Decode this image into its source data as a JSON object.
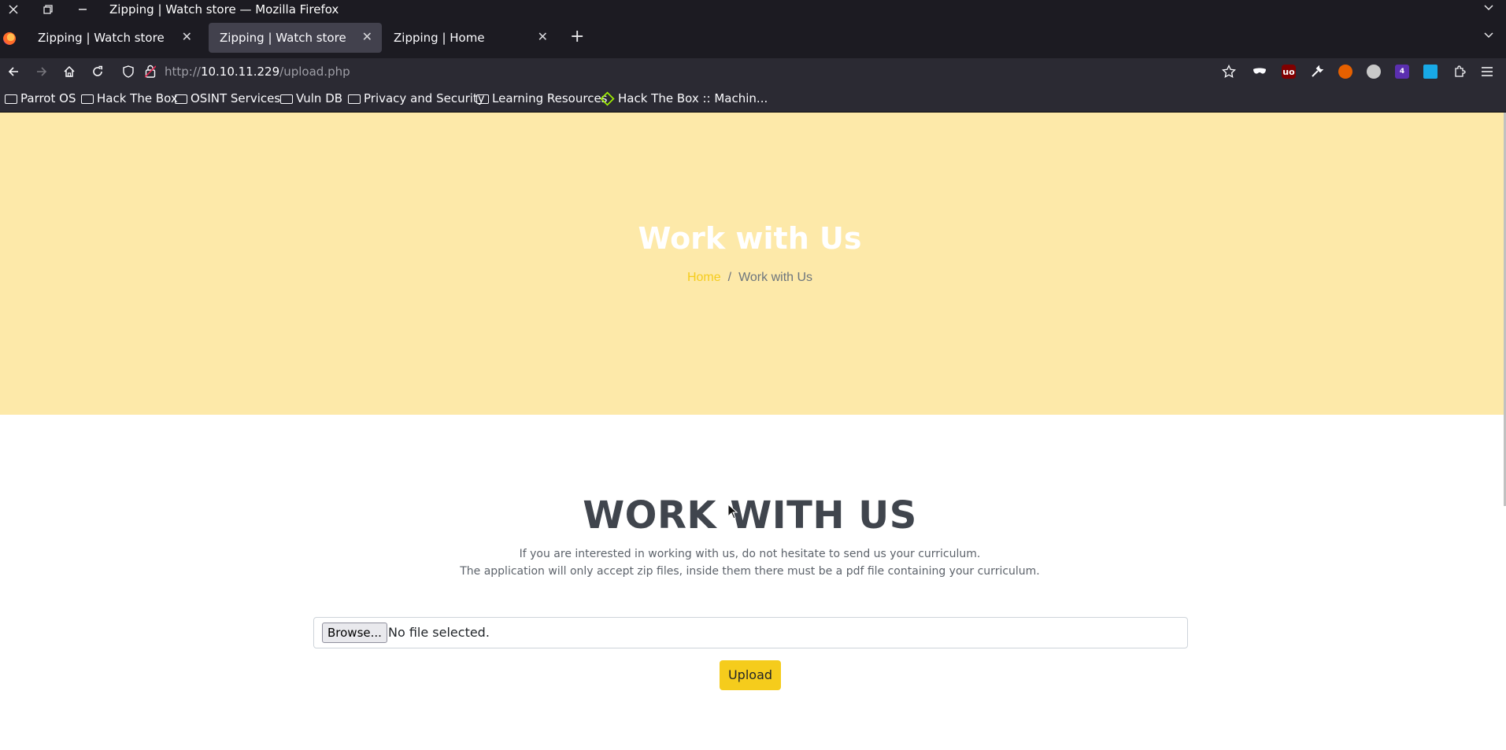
{
  "window": {
    "title": "Zipping | Watch store — Mozilla Firefox"
  },
  "tabs": [
    {
      "label": "Zipping | Watch store",
      "active": false
    },
    {
      "label": "Zipping | Watch store",
      "active": true
    },
    {
      "label": "Zipping | Home",
      "active": false
    }
  ],
  "navbar": {
    "url_prefix": "http://",
    "url_host": "10.10.11.229",
    "url_path": "/upload.php"
  },
  "bookmarks": [
    {
      "label": "Parrot OS",
      "icon": "folder-icon"
    },
    {
      "label": "Hack The Box",
      "icon": "folder-icon"
    },
    {
      "label": "OSINT Services",
      "icon": "folder-icon"
    },
    {
      "label": "Vuln DB",
      "icon": "folder-icon"
    },
    {
      "label": "Privacy and Security",
      "icon": "folder-icon"
    },
    {
      "label": "Learning Resources",
      "icon": "folder-icon"
    },
    {
      "label": "Hack The Box :: Machin...",
      "icon": "htb-cube-icon"
    }
  ],
  "hero": {
    "title": "Work with Us",
    "breadcrumb_home": "Home",
    "breadcrumb_sep": "/",
    "breadcrumb_current": "Work with Us"
  },
  "main": {
    "title": "WORK WITH US",
    "line1": "If you are interested in working with us, do not hesitate to send us your curriculum.",
    "line2": "The application will only accept zip files, inside them there must be a pdf file containing your curriculum.",
    "browse_label": "Browse...",
    "file_status": "No file selected.",
    "upload_label": "Upload"
  },
  "colors": {
    "hero_bg": "#fde9a9",
    "accent": "#f5cc1c",
    "heading": "#40454d"
  }
}
